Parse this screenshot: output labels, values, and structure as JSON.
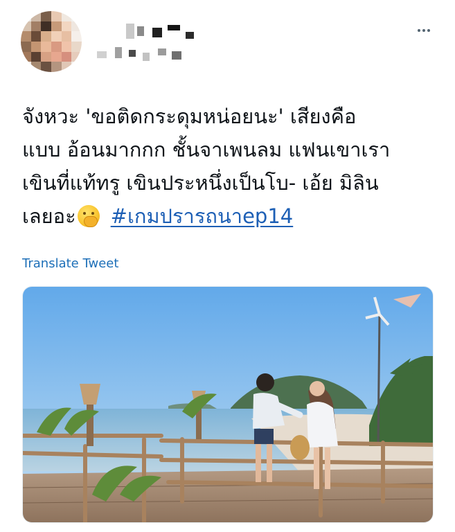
{
  "tweet": {
    "text_lines": [
      "จังหวะ 'ขอติดกระดุมหน่อยนะ' เสียงคือ",
      "แบบ อ้อนมากกก ชั้นจาเพนลม แฟนเขาเรา",
      "เขินที่แท้ทรู เขินประหนึ่งเป็นโบ- เอ้ย มิลิน",
      "เลยอะ"
    ],
    "emoji": "face-with-hand-over-mouth",
    "hashtag": "#เกมปรารถนาep14",
    "translate_label": "Translate Tweet"
  },
  "colors": {
    "link": "#1d5fb5",
    "text": "#0f1419",
    "more_dots": "#536471"
  },
  "icons": {
    "more": "more-horizontal-icon"
  }
}
